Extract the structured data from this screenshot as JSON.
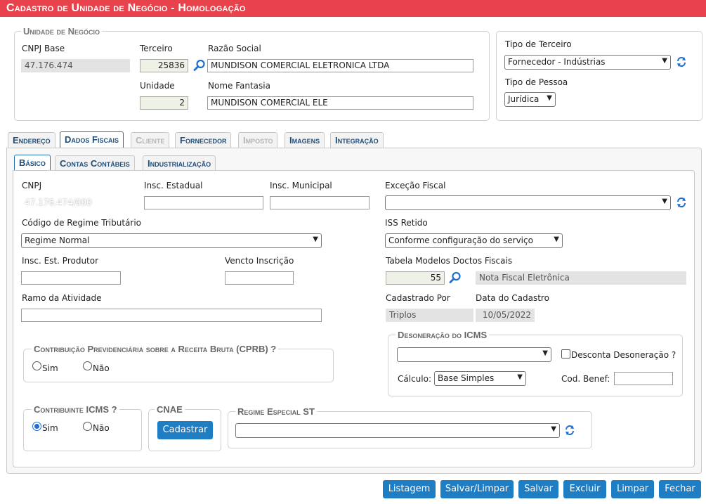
{
  "title": "Cadastro de Unidade de Negócio  - Homologação",
  "unidade": {
    "legend": "Unidade de Negócio",
    "cnpj_base_label": "CNPJ Base",
    "cnpj_base_value": "47.176.474",
    "terceiro_label": "Terceiro",
    "terceiro_value": "25836",
    "razao_label": "Razão Social",
    "razao_value": "MUNDISON COMERCIAL ELETRONICA LTDA",
    "unidade_label": "Unidade",
    "unidade_value": "2",
    "fantasia_label": "Nome Fantasia",
    "fantasia_value": "MUNDISON COMERCIAL ELE"
  },
  "tipo": {
    "terceiro_label": "Tipo de Terceiro",
    "terceiro_value": "Fornecedor - Indústrias",
    "pessoa_label": "Tipo de Pessoa",
    "pessoa_value": "Jurídica"
  },
  "tabs": [
    "Endereço",
    "Dados Fiscais",
    "Cliente",
    "Fornecedor",
    "Imposto",
    "Imagens",
    "Integração"
  ],
  "subtabs": [
    "Básico",
    "Contas Contábeis",
    "Industrialização"
  ],
  "fiscal": {
    "cnpj_label": "CNPJ",
    "cnpj_value": "47.176.474/000",
    "ie_label": "Insc. Estadual",
    "ie_value": "",
    "im_label": "Insc. Municipal",
    "im_value": "",
    "excecao_label": "Exceção Fiscal",
    "excecao_value": "",
    "regime_label": "Código de Regime Tributário",
    "regime_value": "Regime Normal",
    "iss_label": "ISS Retido",
    "iss_value": "Conforme configuração do serviço",
    "produtor_label": "Insc. Est. Produtor",
    "produtor_value": "",
    "vencto_label": "Vencto Inscrição",
    "vencto_value": "",
    "modelos_label": "Tabela Modelos Doctos Fiscais",
    "modelos_code": "55",
    "modelos_desc": "Nota Fiscal Eletrônica",
    "ramo_label": "Ramo da Atividade",
    "ramo_value": "",
    "cadastrado_label": "Cadastrado Por",
    "cadastrado_value": "Triplos",
    "data_label": "Data do Cadastro",
    "data_value": "10/05/2022"
  },
  "cprb": {
    "legend": "Contribuição Previdenciária sobre a Receita Bruta (CPRB) ?",
    "sim": "Sim",
    "nao": "Não",
    "selected": "none"
  },
  "desoneracao": {
    "legend": "Desoneração do ICMS",
    "select_value": "",
    "desconta_label": "Desconta Desoneração ?",
    "calculo_label": "Cálculo:",
    "calculo_value": "Base Simples",
    "cod_benef_label": "Cod. Benef:",
    "cod_benef_value": ""
  },
  "icms": {
    "legend": "Contribuinte ICMS ?",
    "sim": "Sim",
    "nao": "Não",
    "selected": "Sim"
  },
  "cnae": {
    "legend": "CNAE",
    "button": "Cadastrar"
  },
  "regime_st": {
    "legend": "Regime Especial ST",
    "value": ""
  },
  "actions": [
    "Listagem",
    "Salvar/Limpar",
    "Salvar",
    "Excluir",
    "Limpar",
    "Fechar"
  ],
  "colors": {
    "title_bg": "#e8434c",
    "button_bg": "#1f7dc4",
    "icon_blue": "#1f6fd0"
  }
}
